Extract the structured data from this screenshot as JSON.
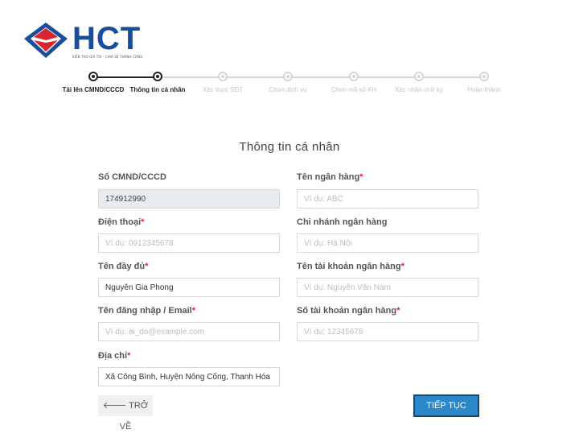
{
  "brand": {
    "name": "HCT",
    "tagline": "KIẾN TẠO GIÁ TRỊ - CHIA SẺ THÀNH CÔNG",
    "primary_color": "#1a4e9c",
    "accent_color": "#d8262e"
  },
  "stepper": {
    "steps": [
      {
        "label": "Tải lên CMND/CCCD",
        "state": "done"
      },
      {
        "label": "Thông tin cá nhân",
        "state": "done"
      },
      {
        "label": "Xác thực SĐT",
        "state": "todo"
      },
      {
        "label": "Chọn dịch vụ",
        "state": "todo"
      },
      {
        "label": "Chọn mã số KH",
        "state": "todo"
      },
      {
        "label": "Xác nhận chữ ký",
        "state": "todo"
      },
      {
        "label": "Hoàn thành",
        "state": "todo"
      }
    ]
  },
  "form": {
    "title": "Thông tin cá nhân",
    "id_number": {
      "label": "Số CMND/CCCD",
      "value": "174912990"
    },
    "phone": {
      "label": "Điện thoại",
      "placeholder": "Ví dụ: 0912345678",
      "value": ""
    },
    "full_name": {
      "label": "Tên đầy đủ",
      "value": "Nguyễn Gia Phong"
    },
    "login": {
      "label": "Tên đăng nhập / Email",
      "placeholder": "Ví dụ: ai_do@example.com",
      "value": ""
    },
    "address": {
      "label": "Địa chỉ",
      "value": "Xã Công Bình, Huyện Nông Cống, Thanh Hóa"
    },
    "bank_name": {
      "label": "Tên ngân hàng",
      "placeholder": "Ví dụ: ABC",
      "value": ""
    },
    "bank_branch": {
      "label": "Chi nhánh ngân hàng",
      "placeholder": "Ví dụ: Hà Nội",
      "value": ""
    },
    "account_name": {
      "label": "Tên tài khoản ngân hàng",
      "placeholder": "Ví dụ: Nguyễn Văn Nam",
      "value": ""
    },
    "account_number": {
      "label": "Số tài khoản ngân hàng",
      "placeholder": "Ví dụ: 12345678",
      "value": ""
    },
    "required_mark": "*"
  },
  "actions": {
    "back_label": "TRỞ VỀ",
    "next_label": "TIẾP TỤC",
    "next_color": "#2b88c8"
  }
}
